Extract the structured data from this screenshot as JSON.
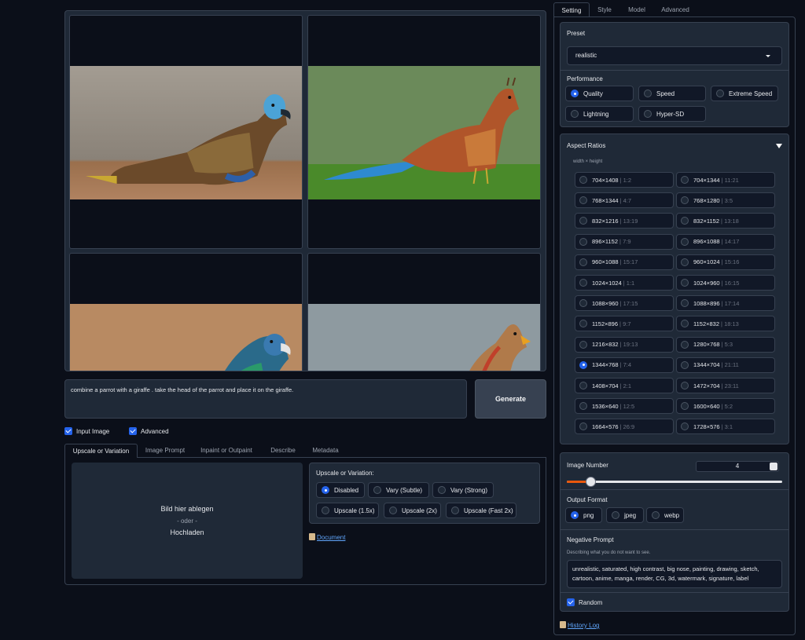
{
  "gallery": {
    "images": [
      {
        "alt": "parrot-giraffe 1"
      },
      {
        "alt": "parrot-giraffe 2"
      },
      {
        "alt": "parrot-giraffe 3"
      },
      {
        "alt": "parrot-giraffe 4"
      }
    ]
  },
  "prompt": {
    "value": "combine a parrot with a giraffe . take the head of the parrot and place it on the giraffe."
  },
  "generate_label": "Generate",
  "checks": {
    "input_image": "Input Image",
    "advanced": "Advanced"
  },
  "bottom_tabs": [
    "Upscale or Variation",
    "Image Prompt",
    "Inpaint or Outpaint",
    "Describe",
    "Metadata"
  ],
  "dropzone": {
    "line1": "Bild hier ablegen",
    "line2": "- oder -",
    "line3": "Hochladen"
  },
  "upscale": {
    "title": "Upscale or Variation:",
    "options": [
      "Disabled",
      "Vary (Subtle)",
      "Vary (Strong)",
      "Upscale (1.5x)",
      "Upscale (2x)",
      "Upscale (Fast 2x)"
    ],
    "selected": "Disabled"
  },
  "document_link": "Document",
  "right_tabs": [
    "Setting",
    "Style",
    "Model",
    "Advanced"
  ],
  "preset": {
    "label": "Preset",
    "value": "realistic"
  },
  "performance": {
    "label": "Performance",
    "options": [
      "Quality",
      "Speed",
      "Extreme Speed",
      "Lightning",
      "Hyper-SD"
    ],
    "selected": "Quality"
  },
  "aspect_ratios": {
    "label": "Aspect Ratios",
    "sublabel": "width × height",
    "options": [
      {
        "size": "704×1408",
        "ratio": "| 1:2"
      },
      {
        "size": "704×1344",
        "ratio": "| 11:21"
      },
      {
        "size": "768×1344",
        "ratio": "| 4:7"
      },
      {
        "size": "768×1280",
        "ratio": "| 3:5"
      },
      {
        "size": "832×1216",
        "ratio": "| 13:19"
      },
      {
        "size": "832×1152",
        "ratio": "| 13:18"
      },
      {
        "size": "896×1152",
        "ratio": "| 7:9"
      },
      {
        "size": "896×1088",
        "ratio": "| 14:17"
      },
      {
        "size": "960×1088",
        "ratio": "| 15:17"
      },
      {
        "size": "960×1024",
        "ratio": "| 15:16"
      },
      {
        "size": "1024×1024",
        "ratio": "| 1:1"
      },
      {
        "size": "1024×960",
        "ratio": "| 16:15"
      },
      {
        "size": "1088×960",
        "ratio": "| 17:15"
      },
      {
        "size": "1088×896",
        "ratio": "| 17:14"
      },
      {
        "size": "1152×896",
        "ratio": "| 9:7"
      },
      {
        "size": "1152×832",
        "ratio": "| 18:13"
      },
      {
        "size": "1216×832",
        "ratio": "| 19:13"
      },
      {
        "size": "1280×768",
        "ratio": "| 5:3"
      },
      {
        "size": "1344×768",
        "ratio": "| 7:4"
      },
      {
        "size": "1344×704",
        "ratio": "| 21:11"
      },
      {
        "size": "1408×704",
        "ratio": "| 2:1"
      },
      {
        "size": "1472×704",
        "ratio": "| 23:11"
      },
      {
        "size": "1536×640",
        "ratio": "| 12:5"
      },
      {
        "size": "1600×640",
        "ratio": "| 5:2"
      },
      {
        "size": "1664×576",
        "ratio": "| 26:9"
      },
      {
        "size": "1728×576",
        "ratio": "| 3:1"
      }
    ],
    "selected": "1344×768"
  },
  "image_number": {
    "label": "Image Number",
    "value": "4",
    "slider_fraction": 0.11
  },
  "output_format": {
    "label": "Output Format",
    "options": [
      "png",
      "jpeg",
      "webp"
    ],
    "selected": "png"
  },
  "negative_prompt": {
    "label": "Negative Prompt",
    "description": "Describing what you do not want to see.",
    "value": "unrealistic, saturated, high contrast, big nose, painting, drawing, sketch, cartoon, anime, manga, render, CG, 3d, watermark, signature, label"
  },
  "random_label": "Random",
  "history_log": "History Log",
  "colors": {
    "accent": "#2563eb",
    "slider": "#ea580c",
    "bg": "#0b0f19",
    "panel": "#1f2937"
  }
}
